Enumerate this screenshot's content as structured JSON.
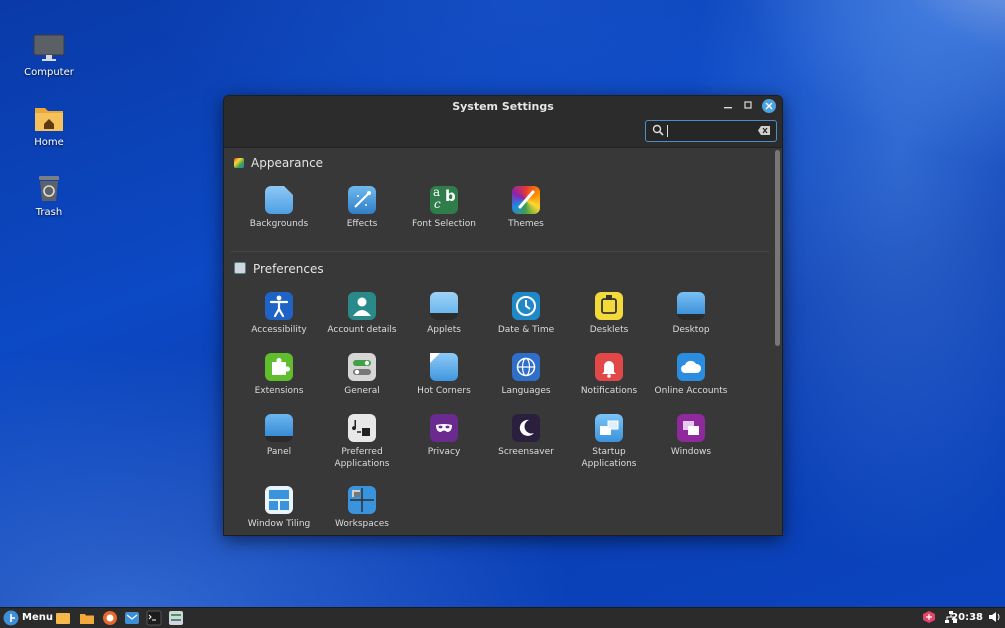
{
  "desktop": {
    "icons": [
      {
        "label": "Computer",
        "icon": "computer-icon"
      },
      {
        "label": "Home",
        "icon": "home-folder-icon"
      },
      {
        "label": "Trash",
        "icon": "trash-icon"
      }
    ]
  },
  "window": {
    "title": "System Settings",
    "search": {
      "value": "",
      "placeholder": ""
    },
    "sections": [
      {
        "title": "Appearance",
        "items": [
          "Backgrounds",
          "Effects",
          "Font Selection",
          "Themes"
        ]
      },
      {
        "title": "Preferences",
        "items": [
          "Accessibility",
          "Account details",
          "Applets",
          "Date & Time",
          "Desklets",
          "Desktop",
          "Extensions",
          "General",
          "Hot Corners",
          "Languages",
          "Notifications",
          "Online Accounts",
          "Panel",
          "Preferred Applications",
          "Privacy",
          "Screensaver",
          "Startup Applications",
          "Windows",
          "Window Tiling",
          "Workspaces"
        ]
      }
    ]
  },
  "taskbar": {
    "menu_label": "Menu",
    "clock": "20:38"
  },
  "colors": {
    "accent": "#4aa3e0",
    "window_bg": "#383838",
    "titlebar_bg": "#2c2c2c"
  }
}
